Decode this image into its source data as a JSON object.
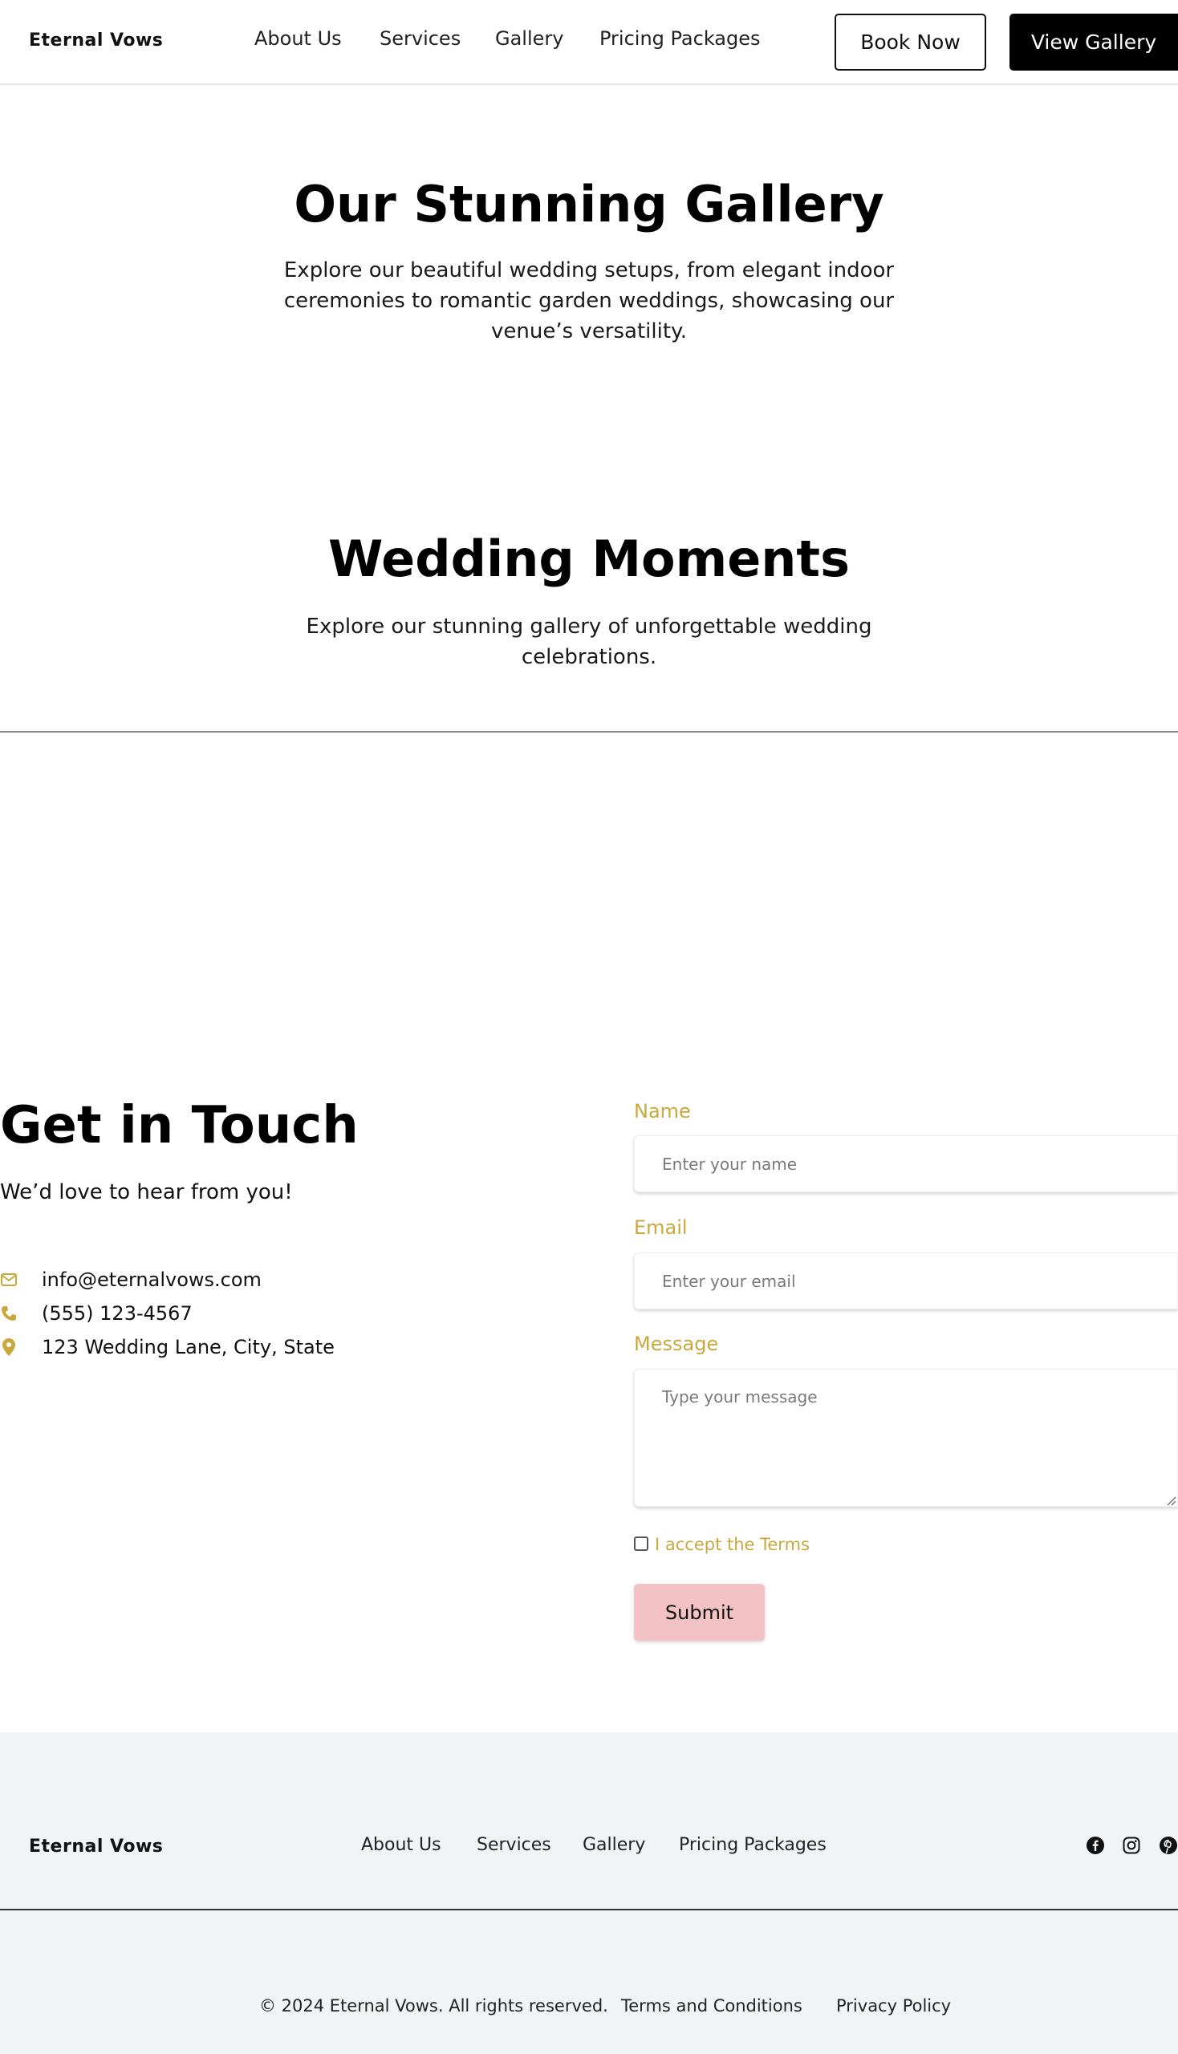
{
  "header": {
    "brand": "Eternal Vows",
    "nav": [
      "About Us",
      "Services",
      "Gallery",
      "Pricing Packages"
    ],
    "book_now": "Book Now",
    "view_gallery": "View Gallery"
  },
  "gallery_intro": {
    "title": "Our Stunning Gallery",
    "text": "Explore our beautiful wedding setups, from elegant indoor ceremonies to romantic garden weddings, showcasing our venue’s versatility."
  },
  "moments": {
    "title": "Wedding Moments",
    "text": "Explore our stunning gallery of unforgettable wedding celebrations."
  },
  "contact": {
    "title": "Get in Touch",
    "subtitle": "We’d love to hear from you!",
    "email": "info@eternalvows.com",
    "phone": "(555) 123-4567",
    "address": "123 Wedding Lane, City, State",
    "icons": [
      "envelope-icon",
      "phone-icon",
      "map-pin-icon"
    ],
    "accent_color": "#c9a83c"
  },
  "form": {
    "name_label": "Name",
    "name_placeholder": "Enter your name",
    "email_label": "Email",
    "email_placeholder": "Enter your email",
    "message_label": "Message",
    "message_placeholder": "Type your message",
    "terms_label": "I accept the Terms",
    "submit_label": "Submit"
  },
  "footer": {
    "brand": "Eternal Vows",
    "nav": [
      "About Us",
      "Services",
      "Gallery",
      "Pricing Packages"
    ],
    "social": [
      "facebook-icon",
      "instagram-icon",
      "pinterest-icon"
    ],
    "copyright": "© 2024 Eternal Vows. All rights reserved.",
    "terms": "Terms and Conditions",
    "privacy": "Privacy Policy"
  }
}
